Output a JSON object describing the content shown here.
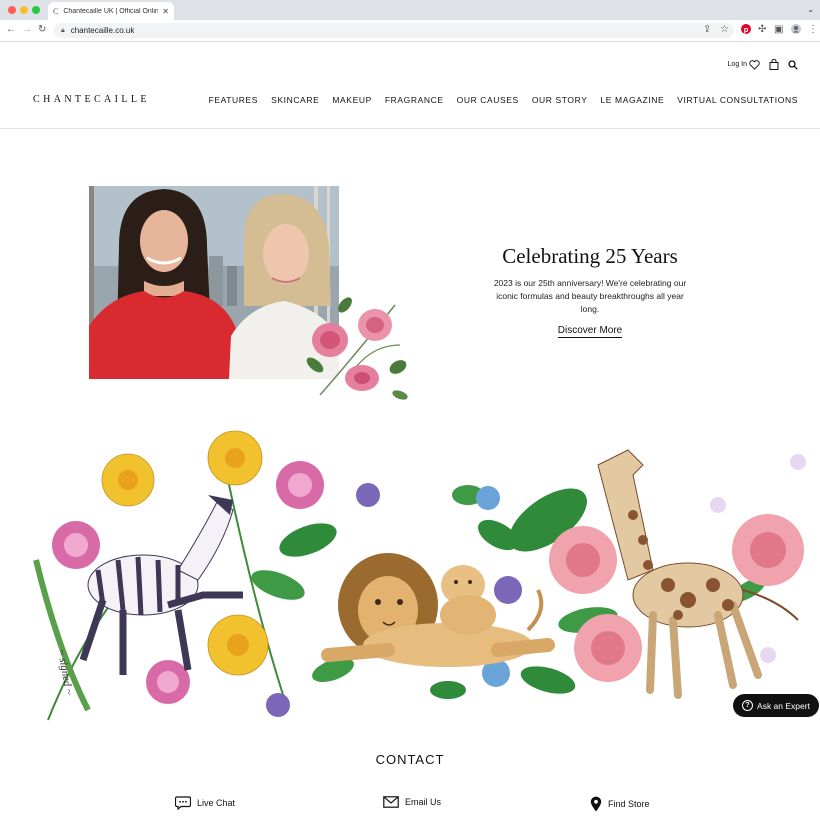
{
  "browser": {
    "tab_title": "Chantecaille UK | Official Onlin",
    "tab_favicon": "C",
    "url": "chantecaille.co.uk"
  },
  "header": {
    "logo": "CHANTECAILLE",
    "login_label": "Log In",
    "nav": [
      "FEATURES",
      "SKINCARE",
      "MAKEUP",
      "FRAGRANCE",
      "OUR CAUSES",
      "OUR STORY",
      "LE MAGAZINE",
      "VIRTUAL CONSULTATIONS"
    ]
  },
  "hero": {
    "title": "Celebrating 25 Years",
    "text": "2023 is our 25th anniversary! We're celebrating our iconic formulas and beauty breakthroughs all year long.",
    "cta": "Discover More"
  },
  "expert": {
    "label": "Ask an Expert"
  },
  "contact": {
    "title": "CONTACT",
    "items": [
      "Live Chat",
      "Email Us",
      "Find Store"
    ]
  },
  "colors": {
    "accent": "#111111",
    "pinterest": "#e60023"
  }
}
